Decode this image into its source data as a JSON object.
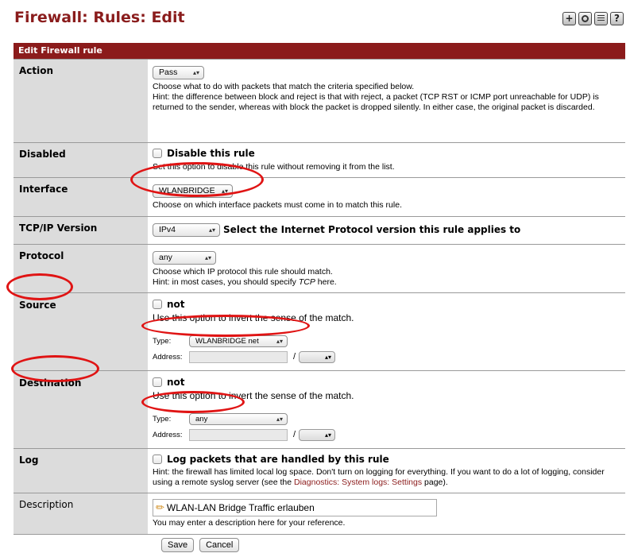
{
  "page": {
    "title": "Firewall: Rules: Edit"
  },
  "top_icons": [
    "add-icon",
    "gear-icon",
    "list-icon",
    "help-icon"
  ],
  "form": {
    "header": "Edit Firewall rule",
    "action": {
      "label": "Action",
      "value": "Pass",
      "hint1": "Choose what to do with packets that match the criteria specified below.",
      "hint2": "Hint: the difference between block and reject is that with reject, a packet (TCP RST or ICMP port unreachable for UDP) is returned to the sender, whereas with block the packet is dropped silently. In either case, the original packet is discarded."
    },
    "disabled": {
      "label": "Disabled",
      "checkbox_label": "Disable this rule",
      "hint": "Set this option to disable this rule without removing it from the list."
    },
    "interface": {
      "label": "Interface",
      "value": "WLANBRIDGE",
      "hint": "Choose on which interface packets must come in to match this rule."
    },
    "ipversion": {
      "label": "TCP/IP Version",
      "value": "IPv4",
      "hint": "Select the Internet Protocol version this rule applies to"
    },
    "protocol": {
      "label": "Protocol",
      "value": "any",
      "hint1": "Choose which IP protocol this rule should match.",
      "hint2_prefix": "Hint: in most cases, you should specify",
      "hint2_em": "TCP",
      "hint2_suffix": "here."
    },
    "source": {
      "label": "Source",
      "not_label": "not",
      "hint": "Use this option to invert the sense of the match.",
      "type_label": "Type:",
      "type_value": "WLANBRIDGE net",
      "address_label": "Address:",
      "slash": "/"
    },
    "destination": {
      "label": "Destination",
      "not_label": "not",
      "hint": "Use this option to invert the sense of the match.",
      "type_label": "Type:",
      "type_value": "any",
      "address_label": "Address:",
      "slash": "/"
    },
    "log": {
      "label": "Log",
      "checkbox_label": "Log packets that are handled by this rule",
      "hint_prefix": "Hint: the firewall has limited local log space. Don't turn on logging for everything. If you want to do a lot of logging, consider using a remote syslog server (see the",
      "hint_link": "Diagnostics: System logs: Settings",
      "hint_suffix": "page)."
    },
    "description": {
      "label": "Description",
      "value": "WLAN-LAN Bridge Traffic erlauben",
      "hint": "You may enter a description here for your reference."
    }
  },
  "buttons": {
    "save": "Save",
    "cancel": "Cancel"
  },
  "annotation_color": "#e01414"
}
